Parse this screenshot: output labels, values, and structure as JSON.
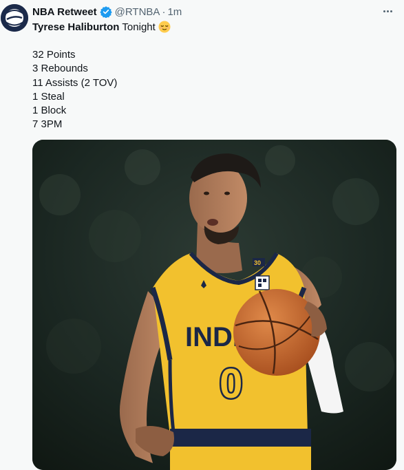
{
  "tweet": {
    "author_name": "NBA Retweet",
    "author_handle": "@RTNBA",
    "separator": "·",
    "time": "1m",
    "headline_bold": "Tyrese Haliburton",
    "headline_rest": "Tonight",
    "stats": [
      "32 Points",
      "3 Rebounds",
      "11 Assists (2 TOV)",
      "1 Steal",
      "1 Block",
      "7 3PM"
    ],
    "avatar_icon": "logo-avatar",
    "verified_icon": "verified-badge-icon",
    "more_icon": "more-options-icon",
    "emoji_icon": "relieved-face-emoji",
    "media": {
      "jersey_wordmark": "INDI",
      "jersey_number": "0",
      "jersey_shoulder_number": "30",
      "accent_colors": {
        "jersey": "#f2c12e",
        "trim": "#1b2747",
        "ball": "#c9642b"
      }
    },
    "colors": {
      "link_blue": "#1d9bf0",
      "muted": "#536471",
      "text": "#0f1419",
      "bg": "#f7f9f9"
    }
  }
}
